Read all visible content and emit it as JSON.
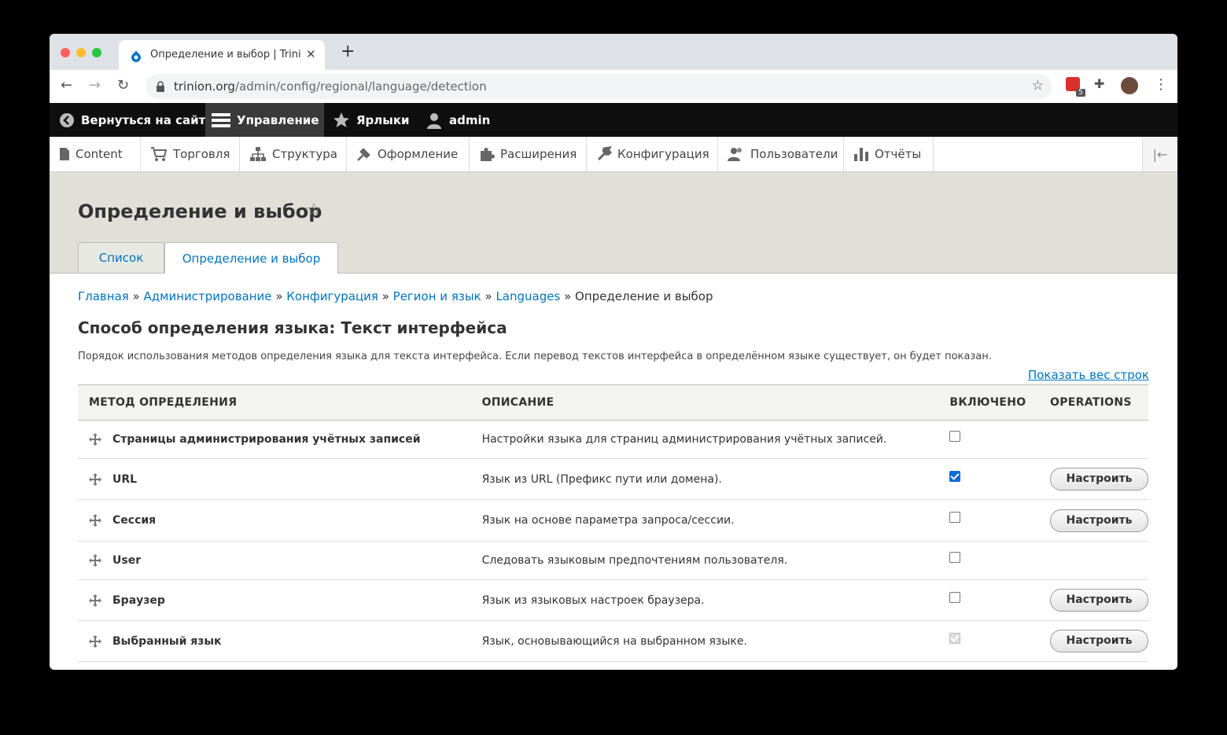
{
  "browser": {
    "tab_title": "Определение и выбор | Trinion",
    "url_host": "trinion.org",
    "url_path": "/admin/config/regional/language/detection",
    "ext_badge": "5"
  },
  "toolbar": {
    "back_to_site": "Вернуться на сайт",
    "manage": "Управление",
    "shortcuts": "Ярлыки",
    "user": "admin"
  },
  "admin_menu": [
    {
      "label": "Content",
      "icon": "file-icon"
    },
    {
      "label": "Торговля",
      "icon": "cart-icon"
    },
    {
      "label": "Структура",
      "icon": "sitemap-icon"
    },
    {
      "label": "Оформление",
      "icon": "brush-icon"
    },
    {
      "label": "Расширения",
      "icon": "puzzle-icon"
    },
    {
      "label": "Конфигурация",
      "icon": "wrench-icon"
    },
    {
      "label": "Пользователи",
      "icon": "people-icon"
    },
    {
      "label": "Отчёты",
      "icon": "bars-icon"
    }
  ],
  "page": {
    "title": "Определение и выбор",
    "tabs": [
      {
        "label": "Список",
        "active": false
      },
      {
        "label": "Определение и выбор",
        "active": true
      }
    ],
    "breadcrumb": [
      "Главная",
      "Администрирование",
      "Конфигурация",
      "Регион и язык",
      "Languages"
    ],
    "breadcrumb_current": "Определение и выбор",
    "section_title": "Способ определения языка: Текст интерфейса",
    "section_desc": "Порядок использования методов определения языка для текста интерфейса. Если перевод текстов интерфейса в определённом языке существует, он будет показан.",
    "show_weights": "Показать вес строк"
  },
  "table": {
    "headers": [
      "МЕТОД ОПРЕДЕЛЕНИЯ",
      "ОПИСАНИЕ",
      "ВКЛЮЧЕНО",
      "OPERATIONS"
    ],
    "configure_label": "Настроить",
    "rows": [
      {
        "method": "Страницы администрирования учётных записей",
        "desc": "Настройки языка для страниц администрирования учётных записей.",
        "enabled": false,
        "disabled": false,
        "configure": false
      },
      {
        "method": "URL",
        "desc": "Язык из URL (Префикс пути или домена).",
        "enabled": true,
        "disabled": false,
        "configure": true
      },
      {
        "method": "Сессия",
        "desc": "Язык на основе параметра запроса/сессии.",
        "enabled": false,
        "disabled": false,
        "configure": true
      },
      {
        "method": "User",
        "desc": "Следовать языковым предпочтениям пользователя.",
        "enabled": false,
        "disabled": false,
        "configure": false
      },
      {
        "method": "Браузер",
        "desc": "Язык из языковых настроек браузера.",
        "enabled": false,
        "disabled": false,
        "configure": true
      },
      {
        "method": "Выбранный язык",
        "desc": "Язык, основывающийся на выбранном языке.",
        "enabled": true,
        "disabled": true,
        "configure": true
      }
    ]
  }
}
